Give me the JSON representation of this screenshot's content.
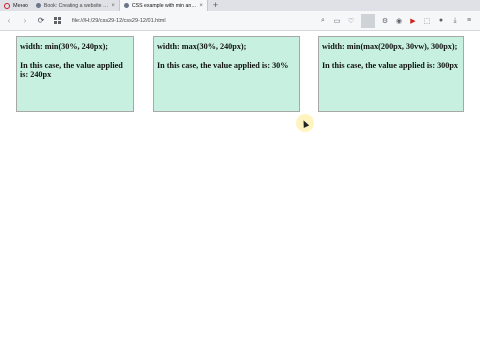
{
  "browser": {
    "menu_label": "Меню",
    "tabs": [
      {
        "title": "Book: Creating a website u...",
        "active": false
      },
      {
        "title": "CSS example with min and m...",
        "active": true
      }
    ],
    "new_tab_symbol": "+",
    "url": "file:///H:/29/css29-12/css29-12/01.html"
  },
  "page": {
    "boxes": [
      {
        "rule": "width: min(30%, 240px);",
        "result": "In this case, the value applied is: 240px"
      },
      {
        "rule": "width: max(30%, 240px);",
        "result": "In this case, the value applied is: 30%"
      },
      {
        "rule": "width: min(max(200px, 30vw), 300px);",
        "result": "In this case, the value applied is: 300px"
      }
    ]
  },
  "colors": {
    "box_background": "#c7f0e1",
    "box_border": "#a8a8a8",
    "tabstrip": "#dfe1e6",
    "opera_red": "#cc1a2a"
  },
  "icons": [
    "opera-logo-icon",
    "back-icon",
    "forward-icon",
    "reload-icon",
    "speed-dial-icon",
    "search-icon",
    "snapshot-icon",
    "heart-icon",
    "settings-icon",
    "camera-icon",
    "youtube-icon",
    "extension-icon",
    "profile-icon",
    "download-icon",
    "menu-icon"
  ]
}
